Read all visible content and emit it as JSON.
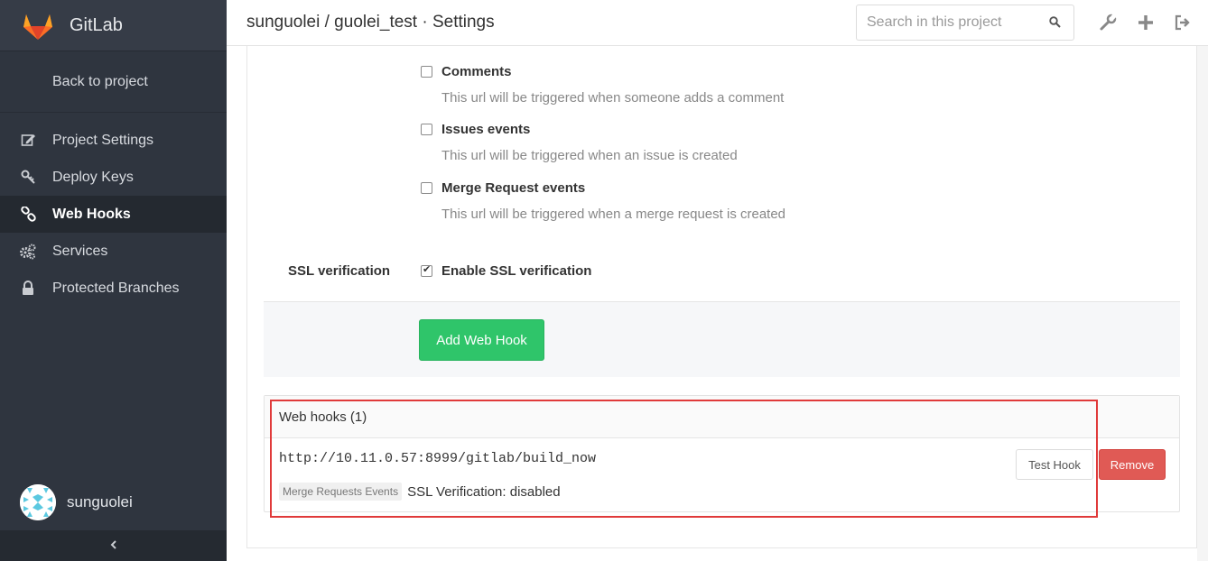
{
  "brand": {
    "name": "GitLab"
  },
  "sidebar": {
    "back_label": "Back to project",
    "items": [
      {
        "label": "Project Settings",
        "icon": "edit-icon",
        "active": false
      },
      {
        "label": "Deploy Keys",
        "icon": "key-icon",
        "active": false
      },
      {
        "label": "Web Hooks",
        "icon": "link-icon",
        "active": true
      },
      {
        "label": "Services",
        "icon": "cogs-icon",
        "active": false
      },
      {
        "label": "Protected Branches",
        "icon": "lock-icon",
        "active": false
      }
    ],
    "username": "sunguolei",
    "collapse_icon": "chevron-left-icon"
  },
  "header": {
    "title": "sunguolei / guolei_test · Settings",
    "search_placeholder": "Search in this project",
    "icons": [
      "wrench-icon",
      "plus-icon",
      "sign-out-icon"
    ]
  },
  "form": {
    "triggers": [
      {
        "label": "Comments",
        "help": "This url will be triggered when someone adds a comment",
        "checked": false
      },
      {
        "label": "Issues events",
        "help": "This url will be triggered when an issue is created",
        "checked": false
      },
      {
        "label": "Merge Request events",
        "help": "This url will be triggered when a merge request is created",
        "checked": false
      }
    ],
    "ssl_label": "SSL verification",
    "ssl_checkbox_label": "Enable SSL verification",
    "ssl_checked": true,
    "add_button": "Add Web Hook"
  },
  "hooks": {
    "title": "Web hooks (1)",
    "list": [
      {
        "url": "http://10.11.0.57:8999/gitlab/build_now",
        "event_tag": "Merge Requests Events",
        "ssl_text": "SSL Verification: disabled",
        "test_label": "Test Hook",
        "remove_label": "Remove"
      }
    ]
  },
  "colors": {
    "sidebar_bg": "#2f353f",
    "add_button": "#2fc56a",
    "remove_button": "#e05a55",
    "highlight_border": "#e03a3a"
  }
}
